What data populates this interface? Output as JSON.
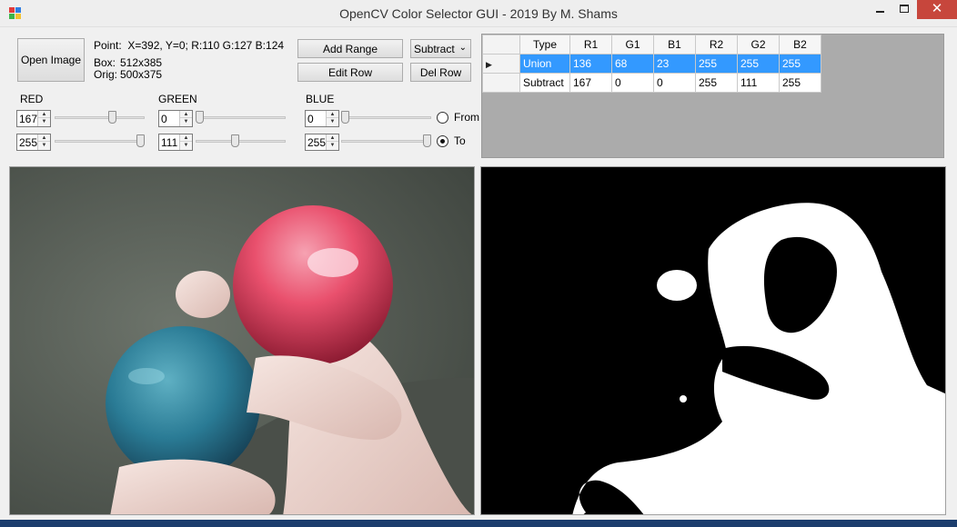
{
  "window": {
    "title": "OpenCV Color Selector GUI - 2019 By M. Shams",
    "close_glyph": "✕"
  },
  "toolbar": {
    "open_image_label": "Open Image",
    "add_range_label": "Add Range",
    "edit_row_label": "Edit Row",
    "del_row_label": "Del Row",
    "mode_select_value": "Subtract"
  },
  "info": {
    "point": "Point:  X=392, Y=0; R:110 G:127 B:124",
    "box_label": "Box:",
    "box_value": "512x385",
    "orig_label": "Orig:",
    "orig_value": "500x375"
  },
  "channels": {
    "red": {
      "label": "RED",
      "from": "167",
      "to": "255",
      "from_level": 0.655,
      "to_level": 1.0
    },
    "green": {
      "label": "GREEN",
      "from": "0",
      "to": "111",
      "from_level": 0.0,
      "to_level": 0.435
    },
    "blue": {
      "label": "BLUE",
      "from": "0",
      "to": "255",
      "from_level": 0.0,
      "to_level": 1.0
    }
  },
  "radios": {
    "from_label": "From",
    "to_label": "To",
    "selected": "To"
  },
  "grid": {
    "columns": [
      "Type",
      "R1",
      "G1",
      "B1",
      "R2",
      "G2",
      "B2"
    ],
    "rows": [
      [
        "Union",
        "136",
        "68",
        "23",
        "255",
        "255",
        "255"
      ],
      [
        "Subtract",
        "167",
        "0",
        "0",
        "255",
        "111",
        "255"
      ]
    ],
    "selected_row": 0
  },
  "colors": {
    "selection": "#3399ff",
    "close_button": "#c7463c",
    "mask_background": "#000000",
    "mask_foreground": "#ffffff"
  },
  "icons": {
    "app": "app-icon",
    "minimize": "minimize-icon",
    "maximize": "maximize-icon",
    "close": "close-icon",
    "row_pointer": "row-pointer-icon"
  }
}
